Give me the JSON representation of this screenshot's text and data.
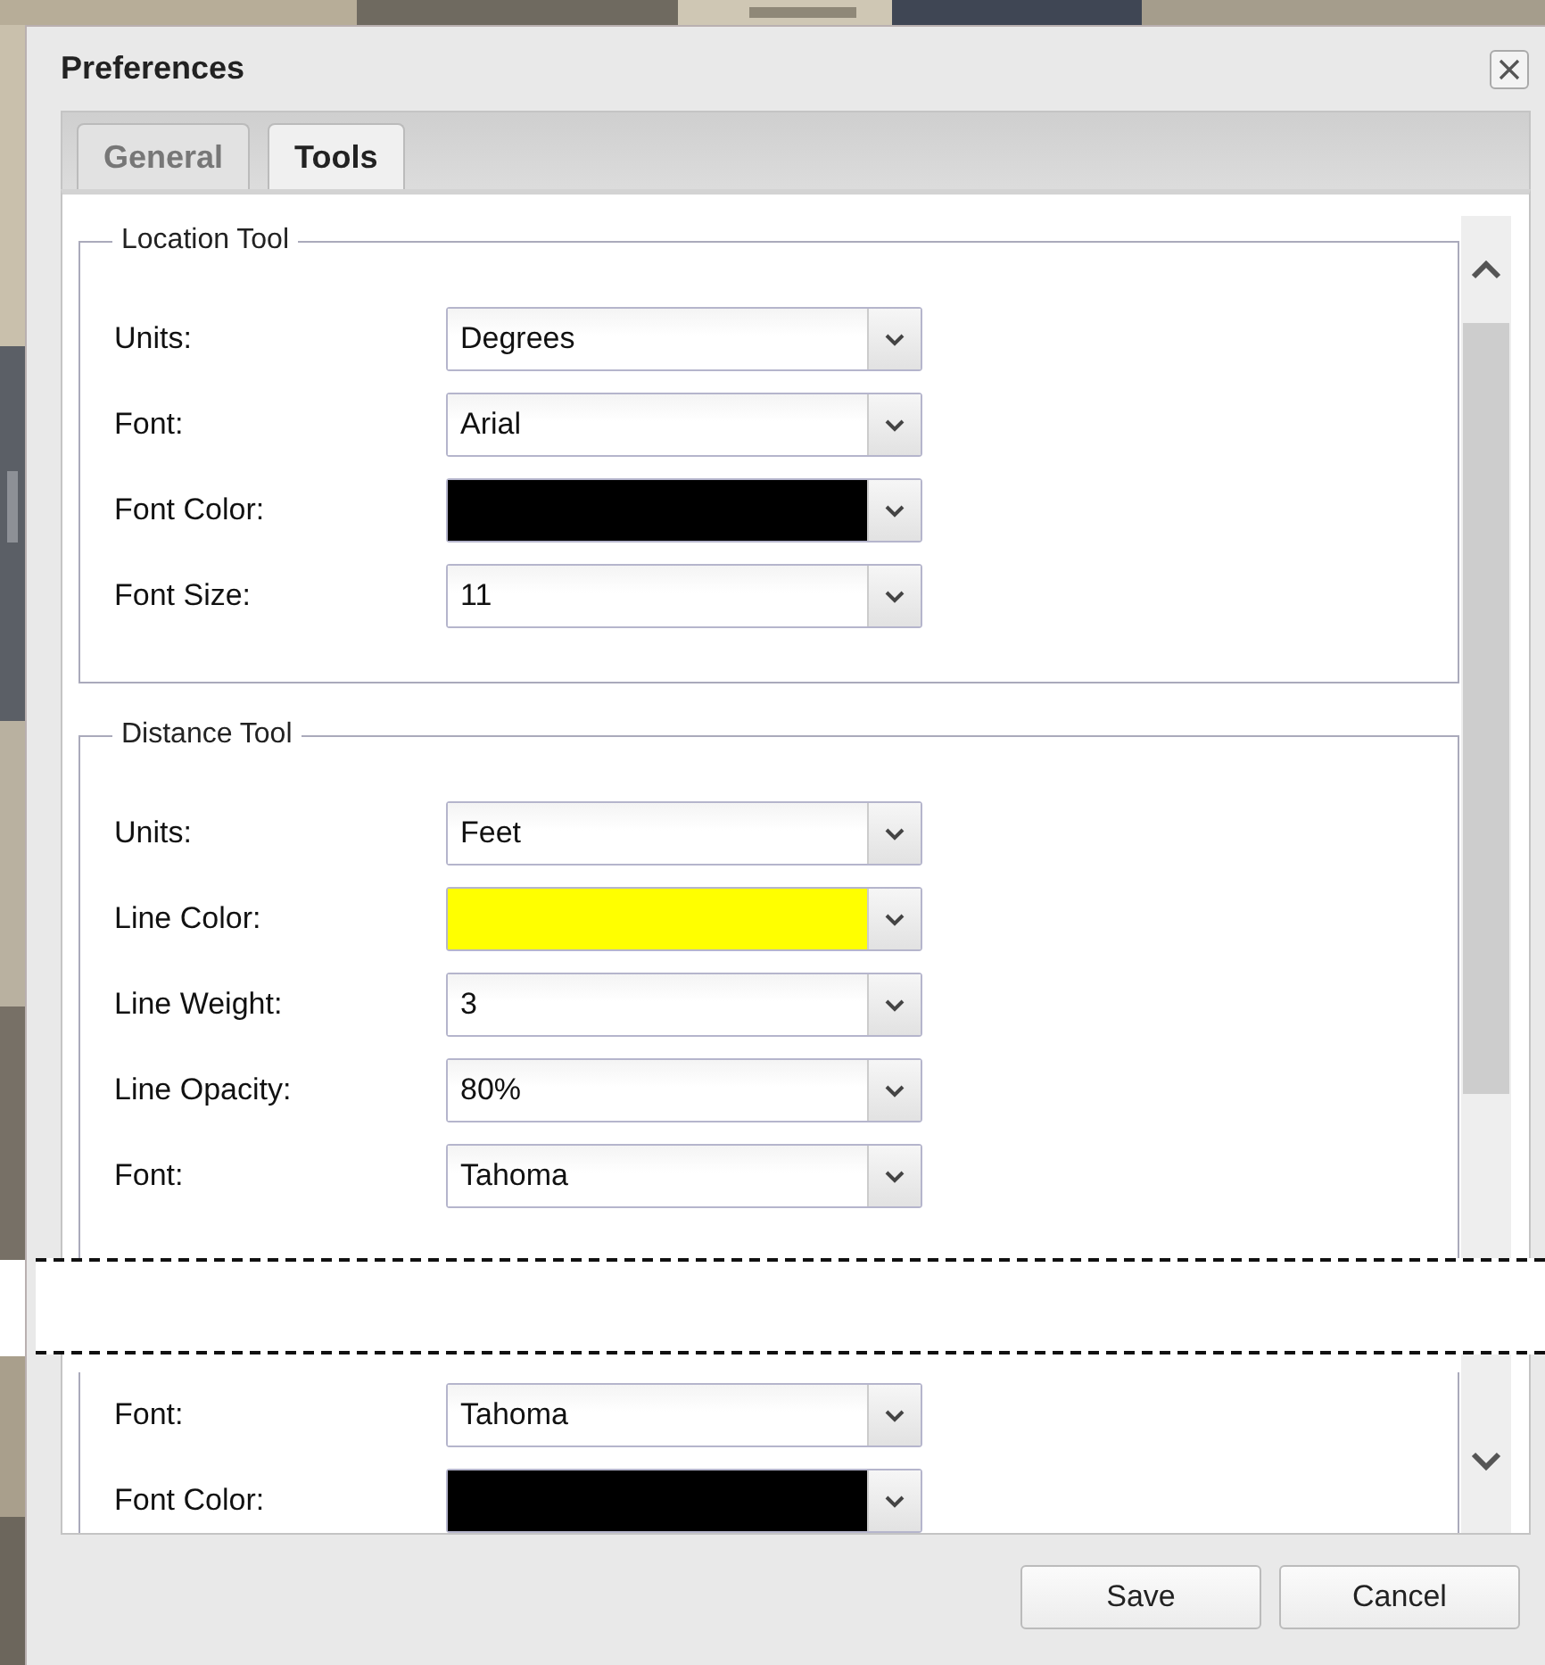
{
  "window": {
    "title": "Preferences"
  },
  "tabs": [
    {
      "label": "General",
      "selected": false
    },
    {
      "label": "Tools",
      "selected": true
    }
  ],
  "top_view": {
    "sections": [
      {
        "legend": "Location Tool",
        "rows": [
          {
            "label": "Units:",
            "kind": "text",
            "value": "Degrees"
          },
          {
            "label": "Font:",
            "kind": "text",
            "value": "Arial"
          },
          {
            "label": "Font Color:",
            "kind": "color",
            "color": "#000000"
          },
          {
            "label": "Font Size:",
            "kind": "text",
            "value": "11"
          }
        ]
      },
      {
        "legend": "Distance Tool",
        "rows": [
          {
            "label": "Units:",
            "kind": "text",
            "value": "Feet"
          },
          {
            "label": "Line Color:",
            "kind": "color",
            "color": "#ffff00"
          },
          {
            "label": "Line Weight:",
            "kind": "text",
            "value": "3"
          },
          {
            "label": "Line Opacity:",
            "kind": "text",
            "value": "80%"
          },
          {
            "label": "Font:",
            "kind": "text",
            "value": "Tahoma"
          }
        ]
      }
    ]
  },
  "bottom_view": {
    "rows": [
      {
        "label": "Font:",
        "kind": "text",
        "value": "Tahoma"
      },
      {
        "label": "Font Color:",
        "kind": "color",
        "color": "#000000"
      }
    ]
  },
  "buttons": [
    "Save",
    "Cancel"
  ]
}
